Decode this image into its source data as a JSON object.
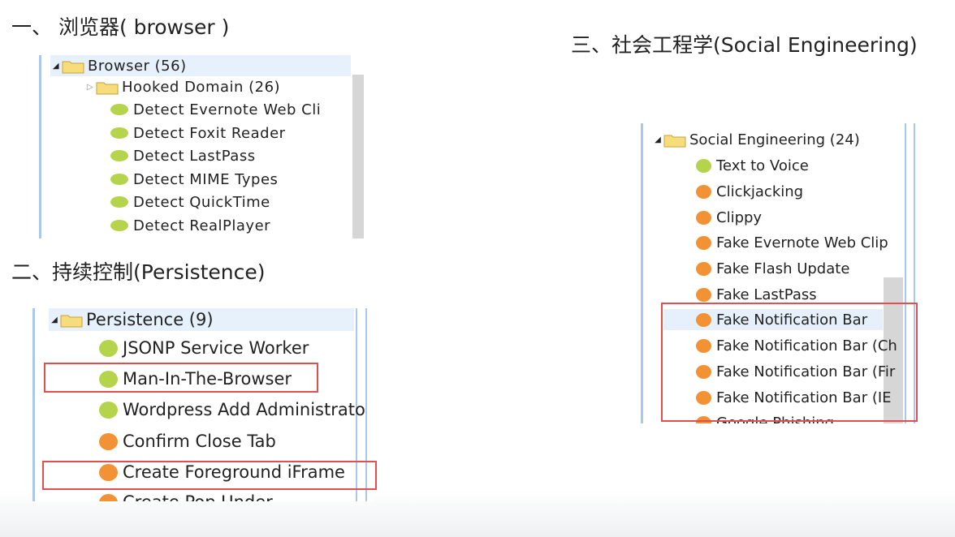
{
  "headings": {
    "browser": "一、 浏览器( browser )",
    "persistence": "二、持续控制(Persistence)",
    "social": "三、社会工程学(Social Engineering)"
  },
  "browser_panel": {
    "parent": "Browser (56)",
    "items": [
      {
        "label": "Hooked Domain (26)",
        "type": "folder"
      },
      {
        "label": "Detect Evernote Web Cli",
        "type": "green"
      },
      {
        "label": "Detect Foxit Reader",
        "type": "green"
      },
      {
        "label": "Detect LastPass",
        "type": "green"
      },
      {
        "label": "Detect MIME Types",
        "type": "green"
      },
      {
        "label": "Detect QuickTime",
        "type": "green"
      },
      {
        "label": "Detect RealPlayer",
        "type": "green"
      }
    ]
  },
  "persistence_panel": {
    "parent": "Persistence (9)",
    "items": [
      {
        "label": "JSONP Service Worker",
        "type": "green"
      },
      {
        "label": "Man-In-The-Browser",
        "type": "green"
      },
      {
        "label": "Wordpress Add Administrato",
        "type": "green"
      },
      {
        "label": "Confirm Close Tab",
        "type": "orange"
      },
      {
        "label": "Create Foreground iFrame",
        "type": "orange"
      },
      {
        "label": "Create Pop Under",
        "type": "orange"
      }
    ]
  },
  "social_panel": {
    "parent": "Social Engineering (24)",
    "items": [
      {
        "label": "Text to Voice",
        "type": "green"
      },
      {
        "label": "Clickjacking",
        "type": "orange"
      },
      {
        "label": "Clippy",
        "type": "orange"
      },
      {
        "label": "Fake Evernote Web Clip",
        "type": "orange"
      },
      {
        "label": "Fake Flash Update",
        "type": "orange"
      },
      {
        "label": "Fake LastPass",
        "type": "orange"
      },
      {
        "label": "Fake Notification Bar",
        "type": "orange"
      },
      {
        "label": "Fake Notification Bar (Ch",
        "type": "orange"
      },
      {
        "label": "Fake Notification Bar (Fir",
        "type": "orange"
      },
      {
        "label": "Fake Notification Bar (IE",
        "type": "orange"
      },
      {
        "label": "Google Phishing",
        "type": "orange"
      }
    ]
  },
  "colors": {
    "green_status": "#b5d44b",
    "orange_status": "#f39234",
    "highlight_box": "#e05050",
    "tree_border": "#a9c8ec"
  }
}
